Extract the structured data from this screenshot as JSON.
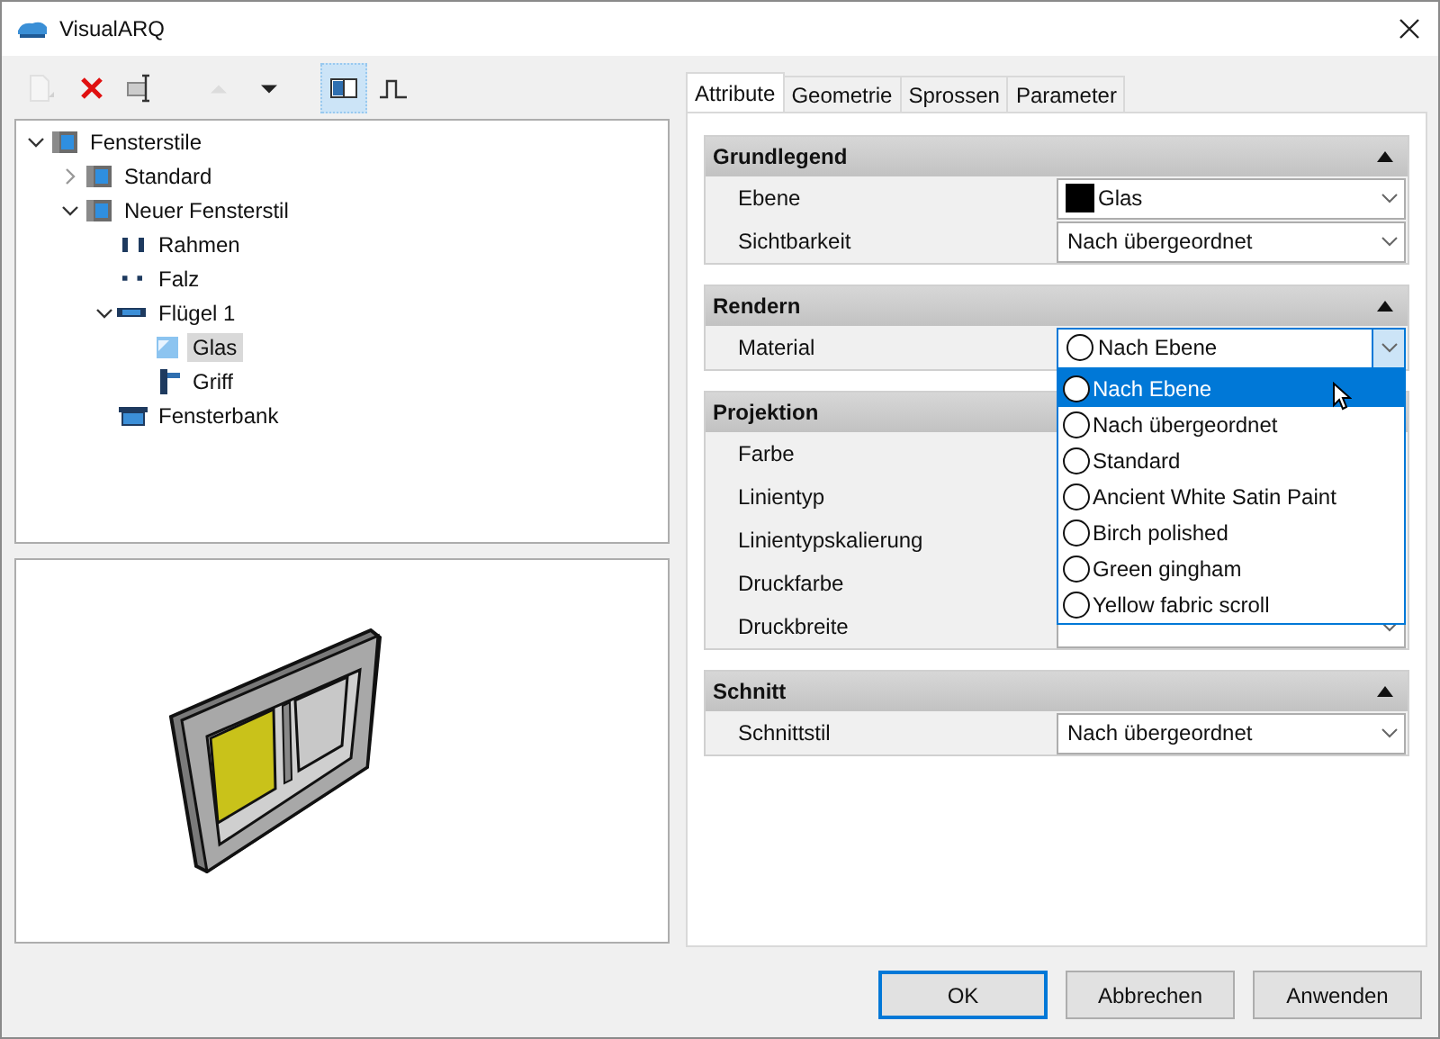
{
  "window": {
    "title": "VisualARQ"
  },
  "toolbar": [
    {
      "kind": "new",
      "disabled": true,
      "selected": false
    },
    {
      "kind": "delete",
      "disabled": false,
      "selected": false
    },
    {
      "kind": "rename",
      "disabled": false,
      "selected": false
    },
    {
      "kind": "up",
      "disabled": true,
      "selected": false
    },
    {
      "kind": "down",
      "disabled": false,
      "selected": false
    },
    {
      "kind": "layout",
      "disabled": false,
      "selected": true
    },
    {
      "kind": "profile",
      "disabled": false,
      "selected": false
    }
  ],
  "tree": [
    {
      "label": "Fensterstile",
      "kind": "style",
      "expanded": true,
      "selected": false,
      "children": [
        {
          "label": "Standard",
          "kind": "style",
          "expanded": false,
          "selected": false
        },
        {
          "label": "Neuer Fensterstil",
          "kind": "style",
          "expanded": true,
          "selected": false,
          "children": [
            {
              "label": "Rahmen",
              "kind": "frame",
              "selected": false
            },
            {
              "label": "Falz",
              "kind": "rebate",
              "selected": false
            },
            {
              "label": "Flügel 1",
              "kind": "sash",
              "expanded": true,
              "selected": false,
              "children": [
                {
                  "label": "Glas",
                  "kind": "glass",
                  "selected": true
                },
                {
                  "label": "Griff",
                  "kind": "handle",
                  "selected": false
                }
              ]
            },
            {
              "label": "Fensterbank",
              "kind": "sill",
              "selected": false
            }
          ]
        }
      ]
    }
  ],
  "tabs": [
    {
      "label": "Attribute",
      "selected": true
    },
    {
      "label": "Geometrie",
      "selected": false
    },
    {
      "label": "Sprossen",
      "selected": false
    },
    {
      "label": "Parameter",
      "selected": false
    }
  ],
  "sections": [
    {
      "title": "Grundlegend",
      "expanded": true,
      "rows": [
        {
          "label": "Ebene",
          "value": "Glas",
          "kind": "layer"
        },
        {
          "label": "Sichtbarkeit",
          "value": "Nach übergeordnet",
          "kind": "combo"
        }
      ]
    },
    {
      "title": "Rendern",
      "expanded": true,
      "rows": [
        {
          "label": "Material",
          "value": "Nach Ebene",
          "kind": "material",
          "open": true
        }
      ]
    },
    {
      "title": "Projektion",
      "rows": [
        {
          "label": "Farbe"
        },
        {
          "label": "Linientyp"
        },
        {
          "label": "Linientypskalierung"
        },
        {
          "label": "Druckfarbe"
        },
        {
          "label": "Druckbreite",
          "kind": "combo"
        }
      ]
    },
    {
      "title": "Schnitt",
      "expanded": true,
      "rows": [
        {
          "label": "Schnittstil",
          "value": "Nach übergeordnet",
          "kind": "combo"
        }
      ]
    }
  ],
  "dropdown": {
    "items": [
      {
        "label": "Nach Ebene",
        "selected": true
      },
      {
        "label": "Nach übergeordnet",
        "selected": false
      },
      {
        "label": "Standard",
        "selected": false
      },
      {
        "label": "Ancient White Satin Paint",
        "selected": false
      },
      {
        "label": "Birch polished",
        "selected": false
      },
      {
        "label": "Green gingham",
        "selected": false
      },
      {
        "label": "Yellow fabric scroll",
        "selected": false
      }
    ]
  },
  "buttons": [
    {
      "label": "OK",
      "default": true
    },
    {
      "label": "Abbrechen",
      "default": false
    },
    {
      "label": "Anwenden",
      "default": false
    }
  ]
}
